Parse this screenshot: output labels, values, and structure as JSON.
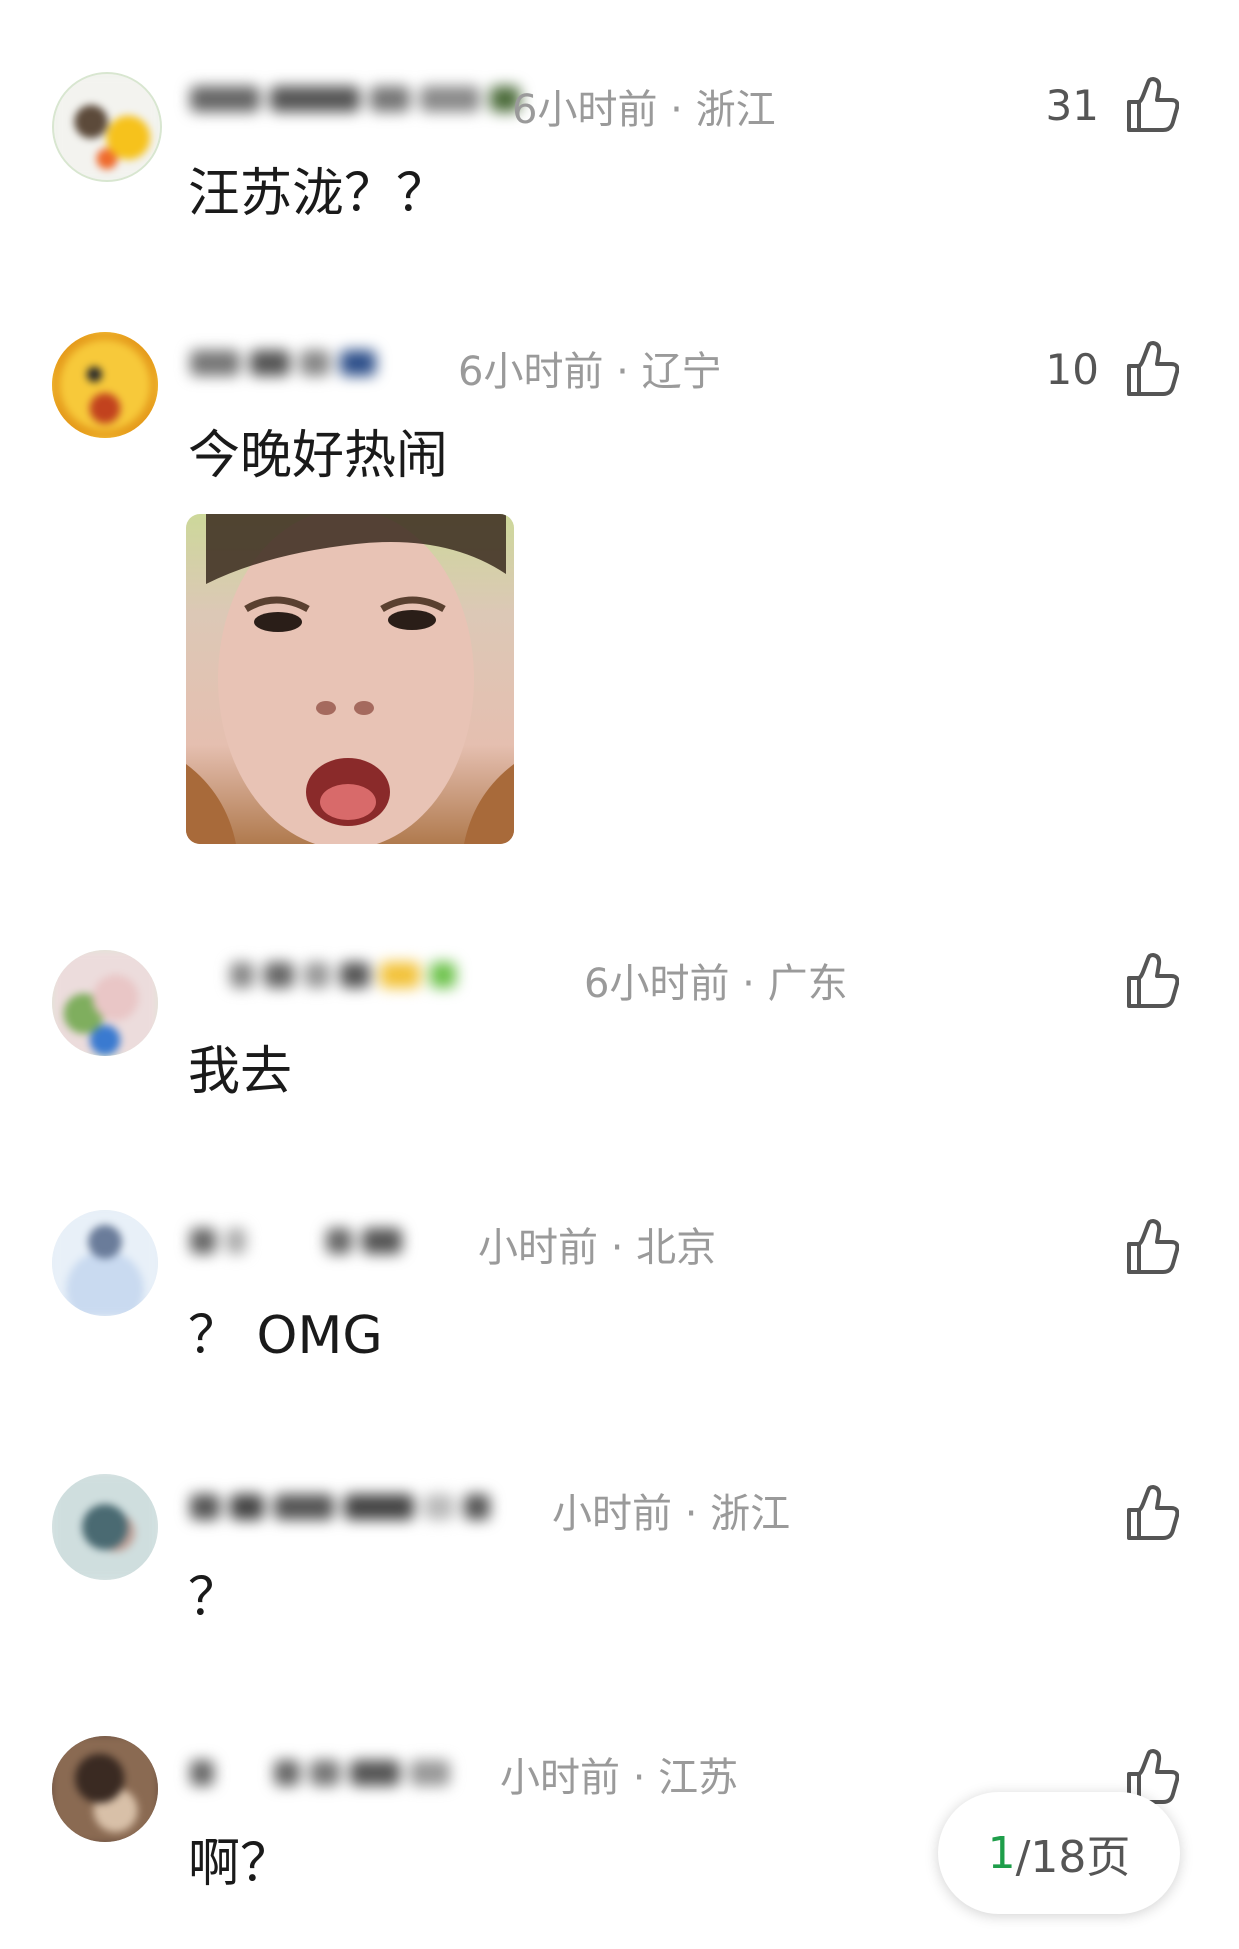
{
  "comments": [
    {
      "meta": "6小时前 · 浙江",
      "likes": "31",
      "text": "汪苏泷？？"
    },
    {
      "meta": "6小时前 · 辽宁",
      "likes": "10",
      "text": "今晚好热闹"
    },
    {
      "meta": "6小时前 · 广东",
      "likes": "",
      "text": "我去"
    },
    {
      "meta": "小时前 · 北京",
      "likes": "",
      "text": "？ OMG"
    },
    {
      "meta": "小时前 · 浙江",
      "likes": "",
      "text": "？"
    },
    {
      "meta": "小时前 · 江苏",
      "likes": "",
      "text": "啊？"
    }
  ],
  "pager": {
    "current": "1",
    "rest": "/18页"
  },
  "colors": {
    "accent": "#1e9e4a",
    "meta": "#9a9a9a"
  },
  "icons": {
    "like": "thumbs-up-icon"
  }
}
